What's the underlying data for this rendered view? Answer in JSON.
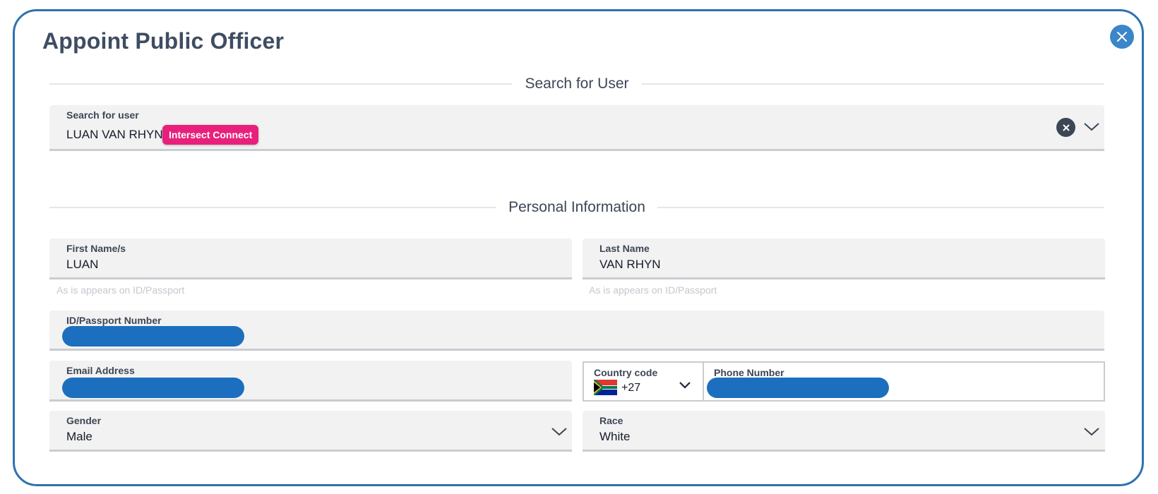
{
  "modal": {
    "title": "Appoint Public Officer",
    "close_icon": "close-icon"
  },
  "sections": {
    "search": "Search for User",
    "personal": "Personal Information"
  },
  "search": {
    "label": "Search for user",
    "value": "LUAN VAN RHYN",
    "badge": "Intersect Connect",
    "clear_icon": "clear-icon",
    "dropdown_icon": "chevron-down-icon"
  },
  "first_name": {
    "label": "First Name/s",
    "value": "LUAN",
    "hint": "As is appears on ID/Passport"
  },
  "last_name": {
    "label": "Last Name",
    "value": "VAN RHYN",
    "hint": "As is appears on ID/Passport"
  },
  "id_number": {
    "label": "ID/Passport Number"
  },
  "email": {
    "label": "Email Address"
  },
  "country_code": {
    "label": "Country code",
    "value": "+27",
    "flag_icon": "south-africa-flag-icon"
  },
  "phone": {
    "label": "Phone Number"
  },
  "gender": {
    "label": "Gender",
    "value": "Male"
  },
  "race": {
    "label": "Race",
    "value": "White"
  },
  "colors": {
    "modal_border": "#2e72b0",
    "badge": "#e8207c",
    "redaction": "#1c6fbe",
    "close_button": "#3a86c8"
  }
}
